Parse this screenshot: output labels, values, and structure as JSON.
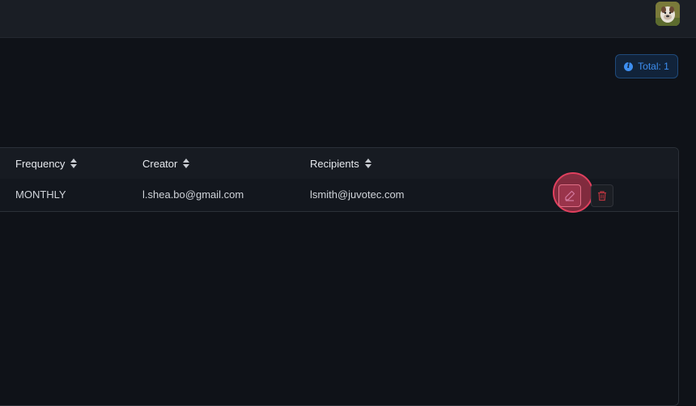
{
  "header": {
    "avatar_icon": "bulldog-avatar"
  },
  "summary": {
    "total_label": "Total: 1",
    "icon": "info-icon"
  },
  "table": {
    "columns": [
      {
        "label": "Frequency",
        "sort_icon": "sort-icon"
      },
      {
        "label": "Creator",
        "sort_icon": "sort-icon"
      },
      {
        "label": "Recipients",
        "sort_icon": "sort-icon"
      }
    ],
    "rows": [
      {
        "frequency": "MONTHLY",
        "creator": "l.shea.bo@gmail.com",
        "recipients": "lsmith@juvotec.com",
        "actions": [
          "edit-icon",
          "trash-icon"
        ]
      }
    ]
  },
  "colors": {
    "accent_blue": "#3d8ef0",
    "danger_red": "#e0405e",
    "background": "#0f1218"
  }
}
